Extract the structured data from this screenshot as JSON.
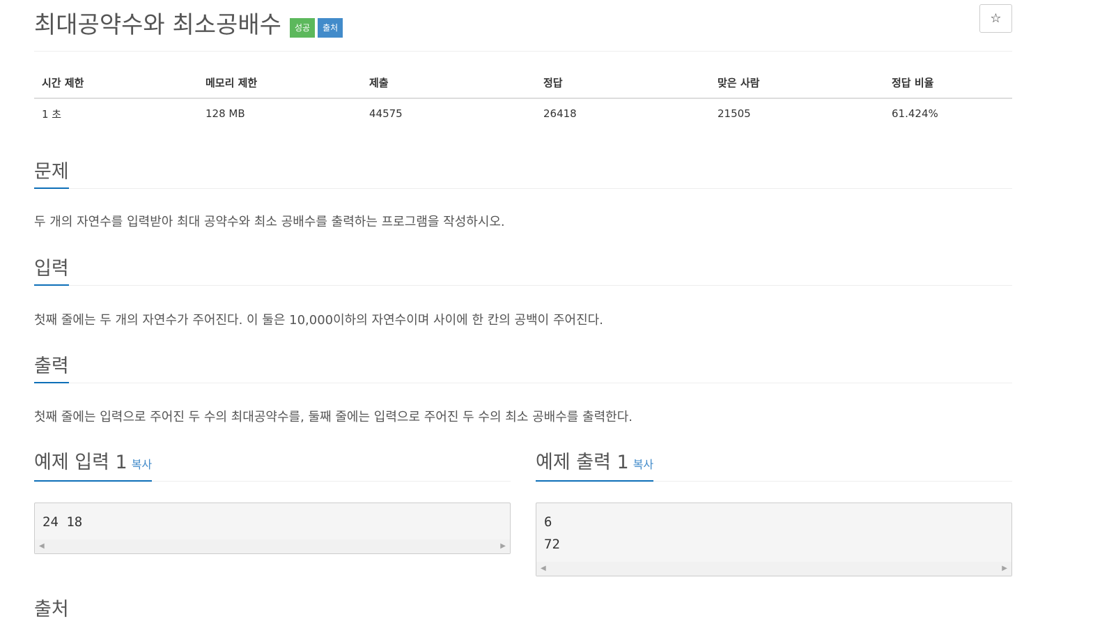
{
  "problem": {
    "title": "최대공약수와 최소공배수",
    "badges": [
      "성공",
      "출처"
    ],
    "star_icon": "☆"
  },
  "info": {
    "headers": [
      "시간 제한",
      "메모리 제한",
      "제출",
      "정답",
      "맞은 사람",
      "정답 비율"
    ],
    "values": [
      "1 초",
      "128 MB",
      "44575",
      "26418",
      "21505",
      "61.424%"
    ]
  },
  "sections": {
    "problem": {
      "title": "문제",
      "text": "두 개의 자연수를 입력받아 최대 공약수와 최소 공배수를 출력하는 프로그램을 작성하시오."
    },
    "input": {
      "title": "입력",
      "text": "첫째 줄에는 두 개의 자연수가 주어진다. 이 둘은 10,000이하의 자연수이며 사이에 한 칸의 공백이 주어진다."
    },
    "output": {
      "title": "출력",
      "text": "첫째 줄에는 입력으로 주어진 두 수의 최대공약수를, 둘째 줄에는 입력으로 주어진 두 수의 최소 공배수를 출력한다."
    }
  },
  "samples": {
    "input": {
      "title": "예제 입력 1",
      "copy": "복사",
      "lines": [
        "24 18"
      ]
    },
    "output": {
      "title": "예제 출력 1",
      "copy": "복사",
      "lines": [
        "6",
        "72"
      ]
    }
  },
  "next_section_partial": "출처",
  "colors": {
    "success": "#5cb85c",
    "info": "#428bca",
    "accent_underline": "#0d6fb8"
  }
}
